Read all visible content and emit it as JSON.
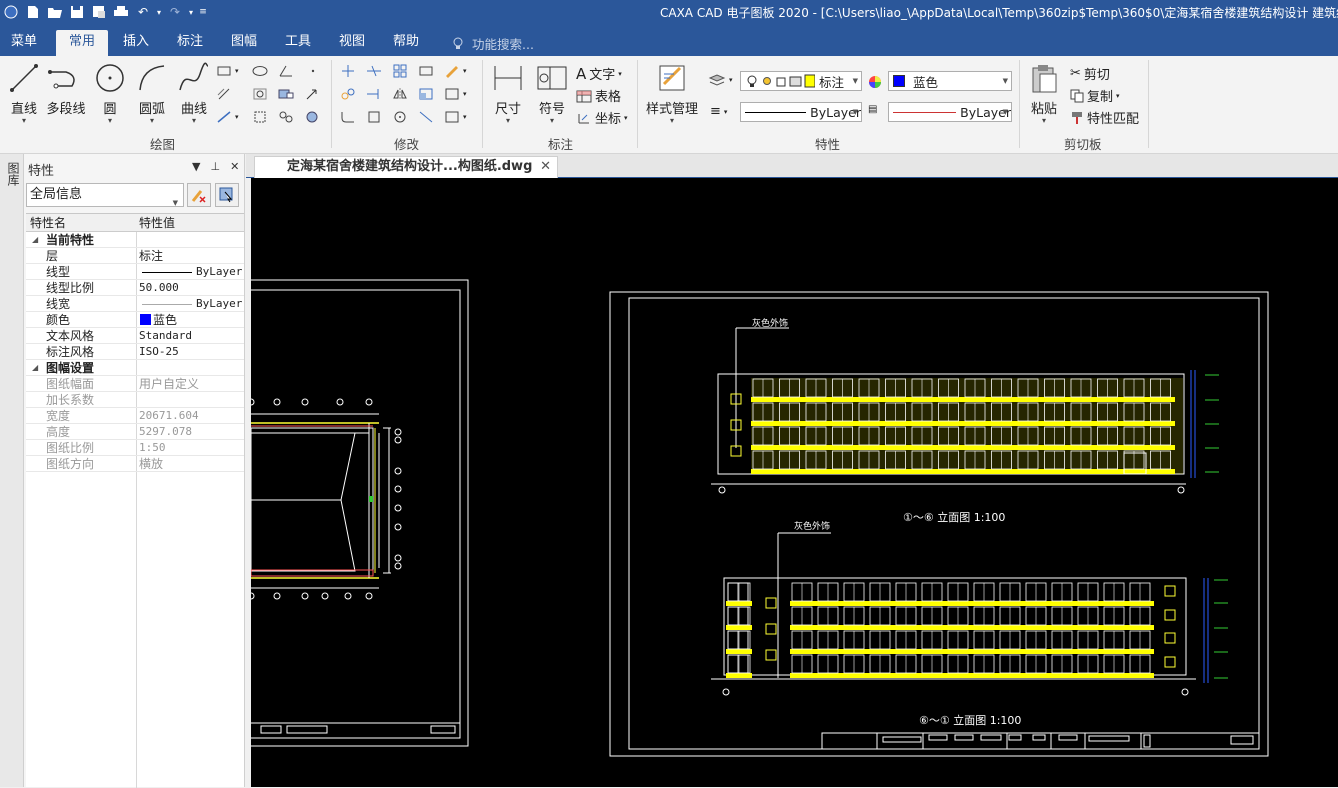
{
  "titlebar": {
    "title": "CAXA CAD 电子图板 2020 - [C:\\Users\\liao_\\AppData\\Local\\Temp\\360zip$Temp\\360$0\\定海某宿舍楼建筑结构设计 建筑结构图"
  },
  "menu": {
    "tabs": [
      "菜单",
      "常用",
      "插入",
      "标注",
      "图幅",
      "工具",
      "视图",
      "帮助"
    ],
    "active": "常用",
    "search_placeholder": "功能搜索..."
  },
  "ribbon": {
    "draw": {
      "label": "绘图",
      "line": "直线",
      "polyline": "多段线",
      "circle": "圆",
      "arc": "圆弧",
      "curve": "曲线"
    },
    "modify": {
      "label": "修改"
    },
    "annotate": {
      "label": "标注",
      "dimension": "尺寸",
      "symbol": "符号",
      "text": "文字",
      "table": "表格",
      "coord": "坐标"
    },
    "properties": {
      "label": "特性",
      "style_manage": "样式管理",
      "layer_value": "标注",
      "color_value": "蓝色",
      "linetype_value": "ByLayer",
      "linewidth_value": "ByLayer"
    },
    "clipboard": {
      "label": "剪切板",
      "paste": "粘贴",
      "cut": "剪切",
      "copy": "复制",
      "match": "特性匹配"
    },
    "colors": {
      "accent": "#2b579a",
      "blue_swatch": "#0000ff",
      "yellow_swatch": "#ffff00"
    }
  },
  "left_strip": {
    "label": "图库"
  },
  "properties_panel": {
    "title": "特性",
    "selector": "全局信息",
    "columns": [
      "特性名",
      "特性值"
    ],
    "sections": [
      {
        "name": "当前特性",
        "rows": [
          {
            "name": "层",
            "value": "标注"
          },
          {
            "name": "线型",
            "value": "ByLayer"
          },
          {
            "name": "线型比例",
            "value": "50.000"
          },
          {
            "name": "线宽",
            "value": "ByLayer"
          },
          {
            "name": "颜色",
            "value": "蓝色"
          },
          {
            "name": "文本风格",
            "value": "Standard"
          },
          {
            "name": "标注风格",
            "value": "ISO-25"
          }
        ]
      },
      {
        "name": "图幅设置",
        "rows": [
          {
            "name": "图纸幅面",
            "value": "用户自定义"
          },
          {
            "name": "加长系数",
            "value": ""
          },
          {
            "name": "宽度",
            "value": "20671.604"
          },
          {
            "name": "高度",
            "value": "5297.078"
          },
          {
            "name": "图纸比例",
            "value": "1:50"
          },
          {
            "name": "图纸方向",
            "value": "横放"
          }
        ]
      }
    ]
  },
  "document": {
    "tab_name": "定海某宿舍楼建筑结构设计...构图纸.dwg"
  },
  "drawing": {
    "label_finish_1": "灰色外饰",
    "label_finish_2": "灰色外饰",
    "caption_1": "①～⑥ 立面图 1:100",
    "caption_2": "⑥～① 立面图 1:100"
  }
}
